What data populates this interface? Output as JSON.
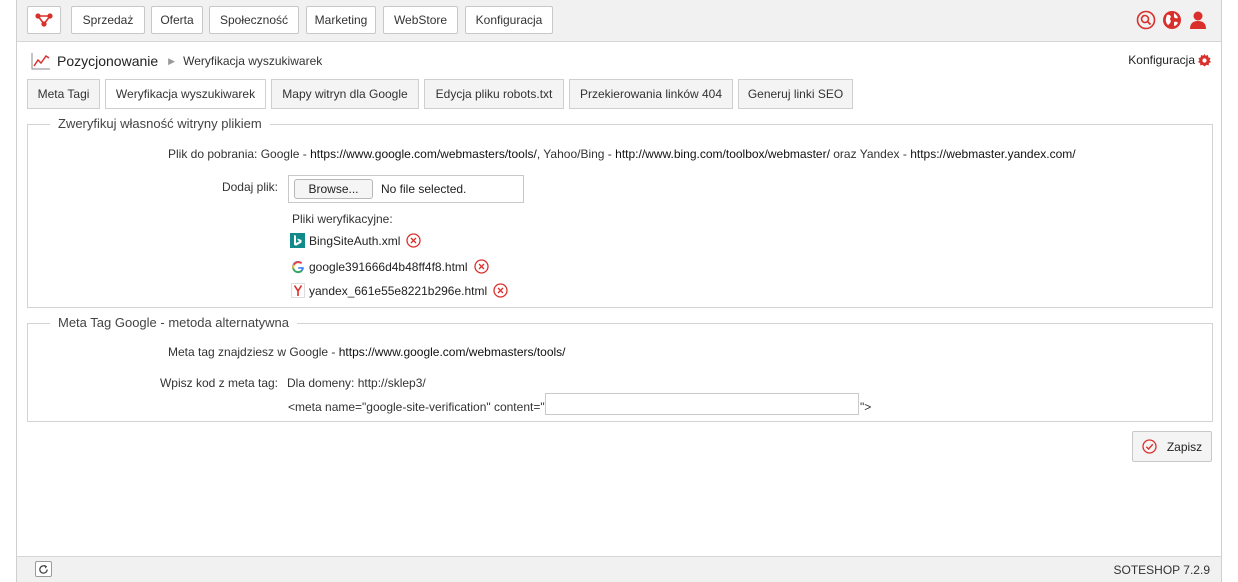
{
  "menu": {
    "items": [
      "Sprzedaż",
      "Oferta",
      "Społeczność",
      "Marketing",
      "WebStore",
      "Konfiguracja"
    ]
  },
  "top_icons": [
    "search-icon",
    "globe-icon",
    "user-icon"
  ],
  "breadcrumb": {
    "main": "Pozycjonowanie",
    "sub": "Weryfikacja wyszukiwarek"
  },
  "config_link": "Konfiguracja",
  "tabs": [
    {
      "label": "Meta Tagi",
      "active": false
    },
    {
      "label": "Weryfikacja wyszukiwarek",
      "active": true
    },
    {
      "label": "Mapy witryn dla Google",
      "active": false
    },
    {
      "label": "Edycja pliku robots.txt",
      "active": false
    },
    {
      "label": "Przekierowania linków 404",
      "active": false
    },
    {
      "label": "Generuj linki SEO",
      "active": false
    }
  ],
  "verify_section": {
    "legend": "Zweryfikuj własność witryny plikiem",
    "download_prefix": "Plik do pobrania: Google - ",
    "google_url": "https://www.google.com/webmasters/tools/",
    "yahoo_text": ", Yahoo/Bing - ",
    "bing_url": "http://www.bing.com/toolbox/webmaster/",
    "yandex_text": " oraz Yandex - ",
    "yandex_url": "https://webmaster.yandex.com/",
    "add_file_label": "Dodaj plik:",
    "browse_label": "Browse...",
    "file_status": "No file selected.",
    "files_heading": "Pliki weryfikacyjne:",
    "files": [
      {
        "name": "BingSiteAuth.xml",
        "icon": "bing-icon"
      },
      {
        "name": "google391666d4b48ff4f8.html",
        "icon": "google-icon"
      },
      {
        "name": "yandex_661e55e8221b296e.html",
        "icon": "yandex-icon"
      }
    ]
  },
  "meta_section": {
    "legend": "Meta Tag Google - metoda alternatywna",
    "info_prefix": "Meta tag znajdziesz w Google - ",
    "info_url": "https://www.google.com/webmasters/tools/",
    "code_label": "Wpisz kod z meta tag:",
    "domain_label": "Dla domeny: ",
    "domain_value": "http://sklep3/",
    "meta_prefix": "<meta name=\"google-site-verification\" content=\"",
    "meta_suffix": "\">",
    "meta_value": ""
  },
  "save_label": "Zapisz",
  "version": "SOTESHOP 7.2.9",
  "colors": {
    "accent": "#d9302c",
    "bing": "#138a8a",
    "yandex": "#e02a2a"
  }
}
